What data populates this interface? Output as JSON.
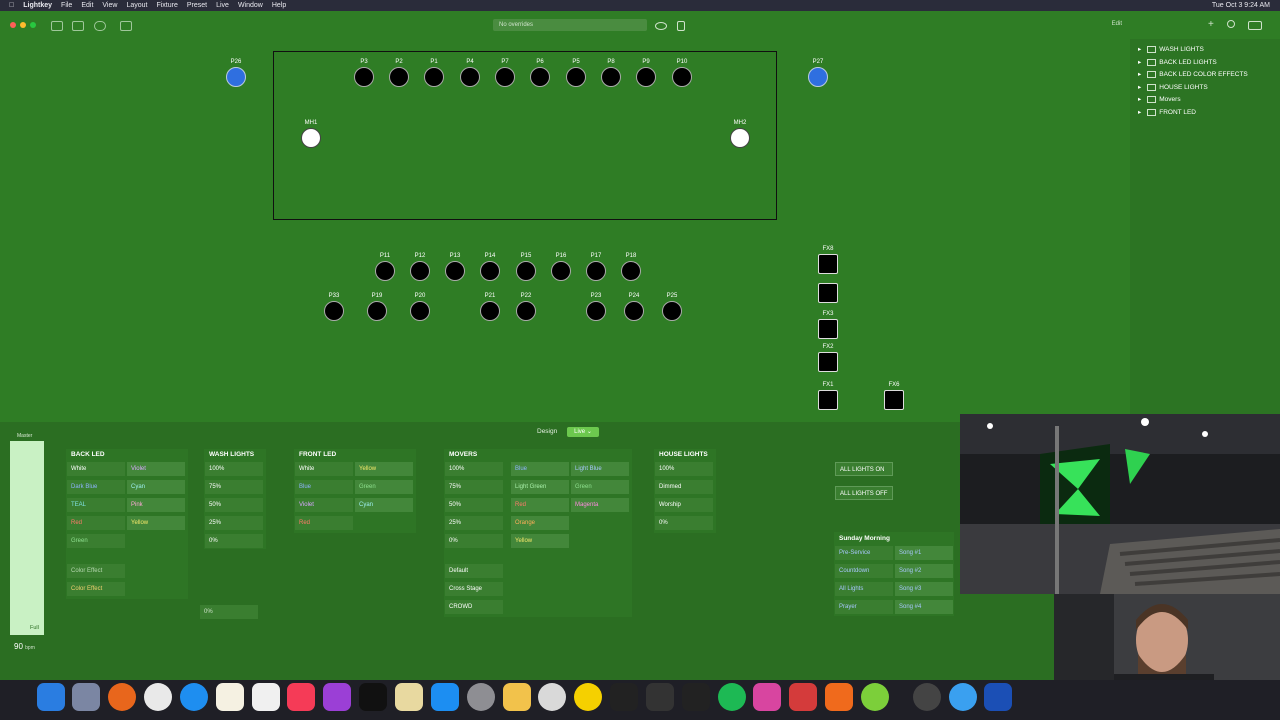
{
  "menubar": {
    "app_name": "Lightkey",
    "items": [
      "File",
      "Edit",
      "View",
      "Layout",
      "Fixture",
      "Preset",
      "Live",
      "Window",
      "Help"
    ],
    "clock": "Tue Oct 3  9:24 AM"
  },
  "toolbar": {
    "search_placeholder": "No overrides",
    "edit_label": "Edit"
  },
  "stage": {
    "top_row": [
      {
        "label": "P26",
        "color": "blue"
      },
      {
        "label": "P3"
      },
      {
        "label": "P2"
      },
      {
        "label": "P1"
      },
      {
        "label": "P4"
      },
      {
        "label": "P7"
      },
      {
        "label": "P6"
      },
      {
        "label": "P5"
      },
      {
        "label": "P8"
      },
      {
        "label": "P9"
      },
      {
        "label": "P10"
      },
      {
        "label": "P27",
        "color": "blue"
      }
    ],
    "movers": [
      {
        "label": "MH1"
      },
      {
        "label": "MH2"
      }
    ],
    "row2": [
      {
        "label": "P11"
      },
      {
        "label": "P12"
      },
      {
        "label": "P13"
      },
      {
        "label": "P14"
      },
      {
        "label": "P15"
      },
      {
        "label": "P16"
      },
      {
        "label": "P17"
      },
      {
        "label": "P18"
      }
    ],
    "row3": [
      {
        "label": "P33"
      },
      {
        "label": "P19"
      },
      {
        "label": "P20"
      },
      {
        "label": "P21"
      },
      {
        "label": "P22"
      },
      {
        "label": "P23"
      },
      {
        "label": "P24"
      },
      {
        "label": "P25"
      }
    ],
    "fx": [
      {
        "label": "FX8"
      },
      {
        "label": ""
      },
      {
        "label": "FX3"
      },
      {
        "label": "FX2"
      },
      {
        "label": "FX1"
      },
      {
        "label": "FX6"
      }
    ]
  },
  "tree": {
    "items": [
      "WASH LIGHTS",
      "BACK LED LIGHTS",
      "BACK LED COLOR EFFECTS",
      "HOUSE LIGHTS",
      "Movers",
      "FRONT LED"
    ]
  },
  "panel": {
    "design_label": "Design",
    "live_label": "Live ⌄",
    "master_label": "Master",
    "fader_full": "Full",
    "bpm": "90",
    "bpm_unit": "bpm"
  },
  "groups": {
    "back_led": {
      "title": "BACK LED",
      "left": [
        "White",
        "Dark Blue",
        "TEAL",
        "Red",
        "Green"
      ],
      "right": [
        "Violet",
        "Cyan",
        "Pink",
        "Yellow"
      ],
      "effects": [
        "Color Effect",
        "Color Effect"
      ]
    },
    "wash_lights": {
      "title": "WASH LIGHTS",
      "cues": [
        "100%",
        "75%",
        "50%",
        "25%",
        "0%"
      ],
      "extra": "0%"
    },
    "front_led": {
      "title": "FRONT LED",
      "left": [
        "White",
        "Blue",
        "Violet",
        "Red"
      ],
      "right": [
        "Yellow",
        "Green",
        "Cyan"
      ]
    },
    "movers": {
      "title": "MOVERS",
      "dimmer": [
        "100%",
        "75%",
        "50%",
        "25%",
        "0%"
      ],
      "col2": [
        "Blue",
        "Light Green",
        "Red",
        "Orange",
        "Yellow"
      ],
      "col3": [
        "Light Blue",
        "Green",
        "Magenta"
      ],
      "positions": [
        "Default",
        "Cross Stage",
        "CROWD"
      ]
    },
    "house_lights": {
      "title": "HOUSE LIGHTS",
      "cues": [
        "100%",
        "Dimmed",
        "Worship",
        "0%"
      ]
    },
    "all_lights": [
      "ALL LIGHTS ON",
      "ALL LIGHTS OFF"
    ],
    "sunday_morning": {
      "title": "Sunday Morning",
      "left": [
        "Pre-Service",
        "Countdown",
        "All Lights",
        "Prayer"
      ],
      "right": [
        "Song #1",
        "Song #2",
        "Song #3",
        "Song #4"
      ]
    }
  }
}
